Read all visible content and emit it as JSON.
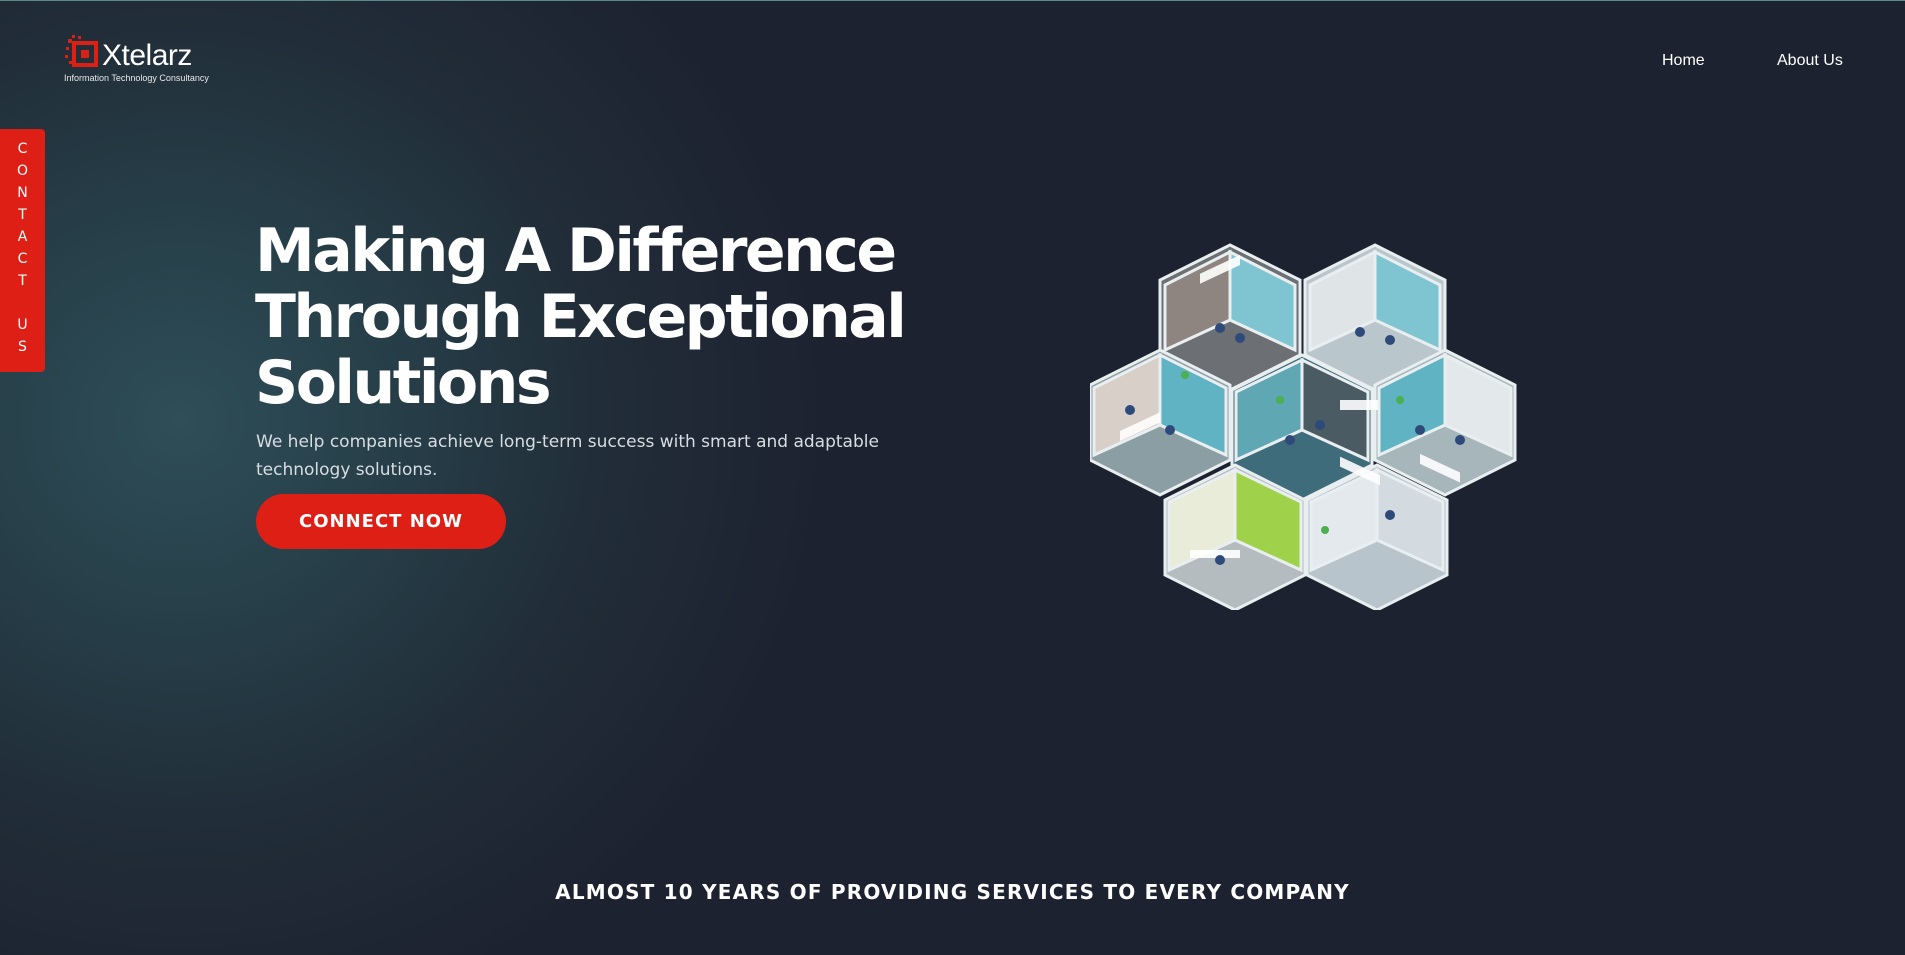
{
  "header": {
    "logo_name": "Xtelarz",
    "logo_tagline": "Information Technology Consultancy",
    "nav": [
      {
        "label": "Home"
      },
      {
        "label": "About Us"
      }
    ]
  },
  "contact_tab": {
    "label": "CONTACT US"
  },
  "hero": {
    "title": "Making A Difference Through Exceptional Solutions",
    "subtitle": "We help companies achieve long-term success with smart and adaptable technology solutions.",
    "cta_label": "CONNECT NOW",
    "illustration": "isometric-hexagon-office-illustration"
  },
  "footer_banner": {
    "text": "ALMOST 10 YEARS OF PROVIDING SERVICES TO EVERY COMPANY"
  },
  "colors": {
    "accent": "#de1f15",
    "background": "#1d2230",
    "background_glow": "#2f4e58",
    "text": "#ffffff"
  }
}
